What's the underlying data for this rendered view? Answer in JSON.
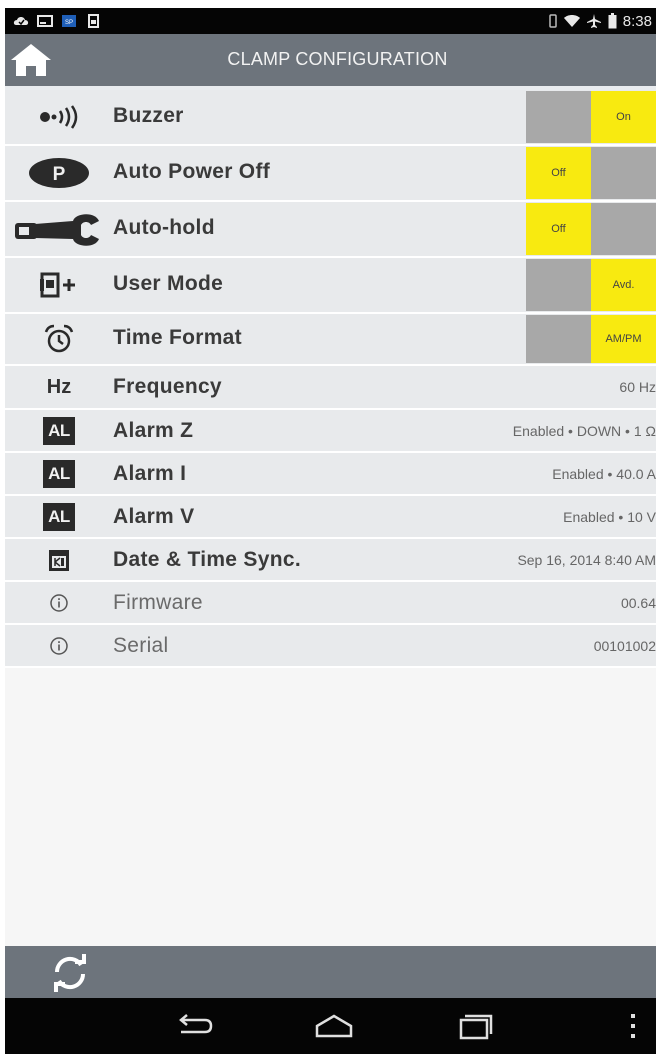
{
  "status_bar": {
    "time": "8:38",
    "left_icons": [
      "cloud-icon",
      "screen-icon",
      "app-badge-icon",
      "sim-icon"
    ],
    "right_icons": [
      "vibrate-icon",
      "wifi-icon",
      "airplane-icon",
      "battery-icon"
    ]
  },
  "header": {
    "title": "CLAMP CONFIGURATION",
    "home_icon": "home-icon"
  },
  "colors": {
    "header_bg": "#6d747c",
    "toggle_active": "#f8ea10",
    "toggle_inactive": "#a8a8a8",
    "row_bg": "#e8eaec"
  },
  "settings": [
    {
      "label": "Buzzer",
      "icon": "buzzer-icon",
      "type": "toggle",
      "state": "On",
      "left_text": "",
      "right_text": "On"
    },
    {
      "label": "Auto Power Off",
      "icon": "power-p-icon",
      "type": "toggle",
      "state": "Off",
      "left_text": "Off",
      "right_text": ""
    },
    {
      "label": "Auto-hold",
      "icon": "clamp-icon",
      "type": "toggle",
      "state": "Off",
      "left_text": "Off",
      "right_text": ""
    },
    {
      "label": "User Mode",
      "icon": "user-mode-icon",
      "type": "toggle",
      "state": "Avd.",
      "left_text": "",
      "right_text": "Avd."
    },
    {
      "label": "Time Format",
      "icon": "alarm-clock-icon",
      "type": "toggle",
      "state": "AM/PM",
      "left_text": "",
      "right_text": "AM/PM"
    },
    {
      "label": "Frequency",
      "icon": "hz-icon",
      "icon_text": "Hz",
      "type": "value",
      "value": "60 Hz"
    },
    {
      "label": "Alarm Z",
      "icon": "alarm-al-icon",
      "icon_text": "AL",
      "type": "value",
      "value": "Enabled • DOWN • 1  Ω"
    },
    {
      "label": "Alarm I",
      "icon": "alarm-al-icon",
      "icon_text": "AL",
      "type": "value",
      "value": "Enabled • 40.0  A"
    },
    {
      "label": "Alarm V",
      "icon": "alarm-al-icon",
      "icon_text": "AL",
      "type": "value",
      "value": "Enabled • 10  V"
    },
    {
      "label": "Date & Time Sync.",
      "icon": "sync-calendar-icon",
      "type": "value",
      "value": "Sep 16, 2014 8:40 AM"
    },
    {
      "label": "Firmware",
      "icon": "info-icon",
      "type": "info",
      "value": "00.64"
    },
    {
      "label": "Serial",
      "icon": "info-icon",
      "type": "info",
      "value": "00101002"
    }
  ],
  "bottom_bar": {
    "refresh_icon": "refresh-icon"
  },
  "nav_bar": {
    "buttons": [
      "back-icon",
      "home-nav-icon",
      "recents-icon",
      "overflow-menu-icon"
    ]
  }
}
